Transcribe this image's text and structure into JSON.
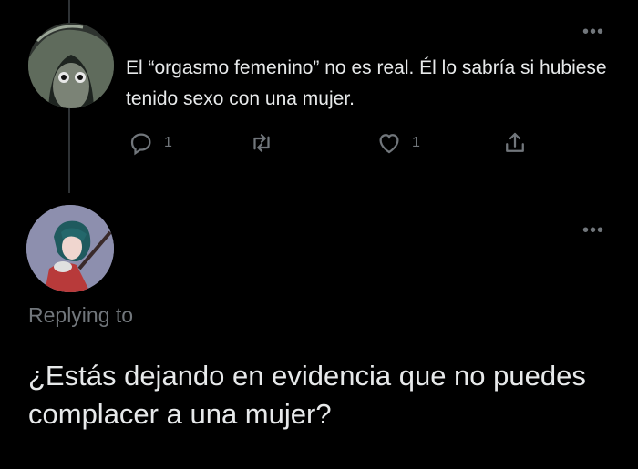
{
  "tweet": {
    "text": "El “orgasmo femenino” no es real. Él lo sabría si hubiese tenido sexo con una mujer.",
    "reply_count": "1",
    "like_count": "1",
    "icons": [
      "reply-icon",
      "retweet-icon",
      "like-icon",
      "share-icon",
      "more-icon"
    ]
  },
  "reply": {
    "replying_to": "Replying to",
    "text": "¿Estás dejando en evidencia que no puedes complacer a una mujer?"
  },
  "colors": {
    "background": "#000000",
    "text": "#e7e9ea",
    "muted": "#71767b",
    "thread_line": "#2f3336"
  }
}
